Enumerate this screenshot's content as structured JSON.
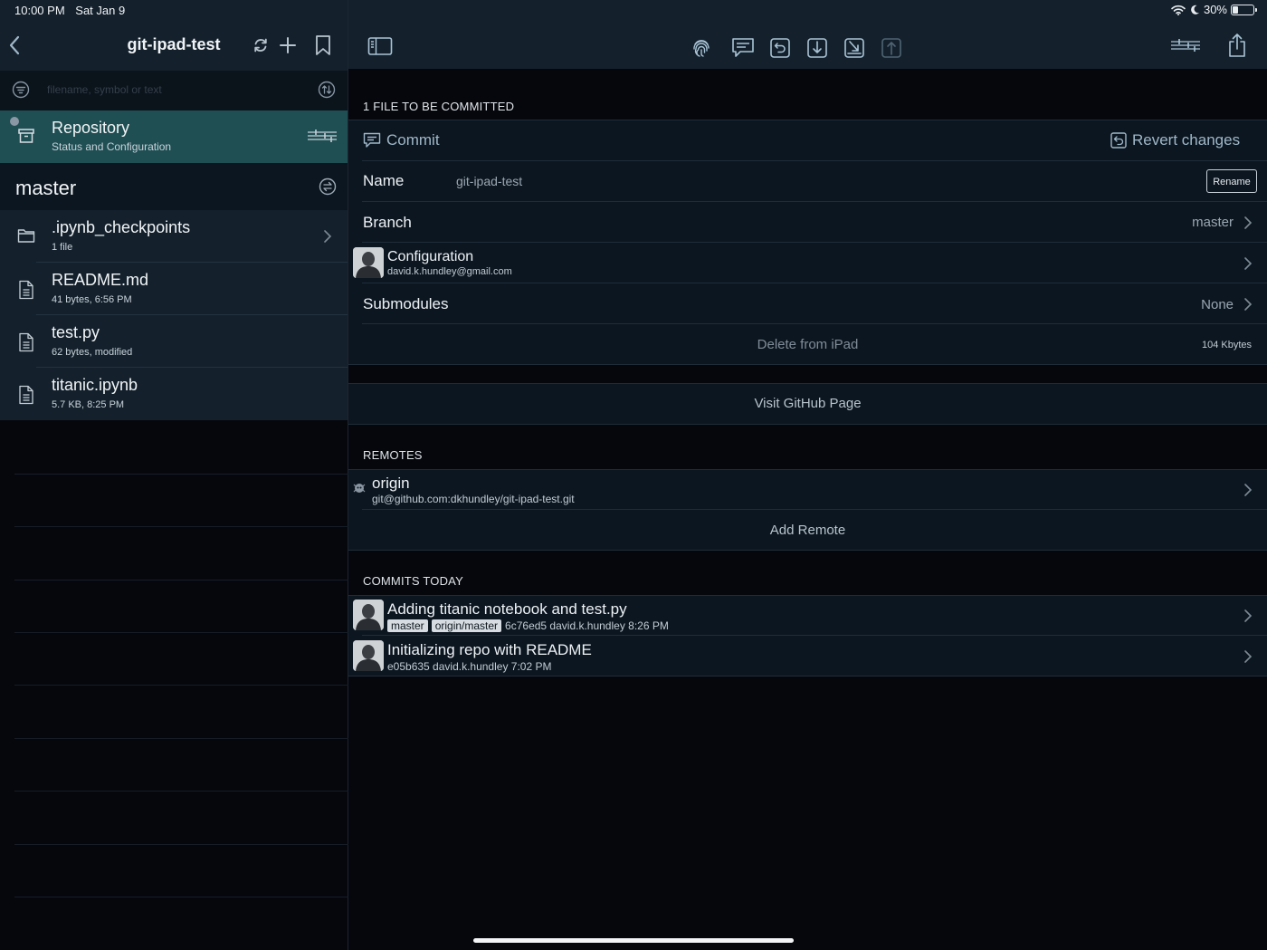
{
  "status_bar": {
    "time": "10:00 PM",
    "date": "Sat Jan 9",
    "battery": "30%",
    "battery_level": 0.3
  },
  "sidebar": {
    "title": "git-ipad-test",
    "search_placeholder": "filename, symbol or text",
    "repository": {
      "title": "Repository",
      "subtitle": "Status and Configuration"
    },
    "branch": "master",
    "files": [
      {
        "name": ".ipynb_checkpoints",
        "detail": "1 file",
        "icon": "folder-icon"
      },
      {
        "name": "README.md",
        "detail": "41 bytes, 6:56 PM",
        "icon": "file-icon"
      },
      {
        "name": "test.py",
        "detail": "62 bytes, modified",
        "icon": "file-icon"
      },
      {
        "name": "titanic.ipynb",
        "detail": "5.7 KB, 8:25 PM",
        "icon": "file-icon"
      }
    ]
  },
  "main": {
    "commit_section": {
      "header": "1 FILE TO BE COMMITTED",
      "commit_label": "Commit",
      "revert_label": "Revert changes"
    },
    "name_row": {
      "label": "Name",
      "value": "git-ipad-test",
      "rename_label": "Rename"
    },
    "branch_row": {
      "label": "Branch",
      "value": "master"
    },
    "configuration_row": {
      "label": "Configuration",
      "email": "david.k.hundley@gmail.com"
    },
    "submodules_row": {
      "label": "Submodules",
      "value": "None"
    },
    "delete_row": {
      "label": "Delete from iPad",
      "size": "104 Kbytes"
    },
    "visit_github_label": "Visit GitHub Page",
    "remotes": {
      "header": "REMOTES",
      "items": [
        {
          "name": "origin",
          "url": "git@github.com:dkhundley/git-ipad-test.git"
        }
      ],
      "add_label": "Add Remote"
    },
    "commits": {
      "header": "COMMITS TODAY",
      "items": [
        {
          "message": "Adding titanic notebook and test.py",
          "tags": [
            "master",
            "origin/master"
          ],
          "meta": "6c76ed5 david.k.hundley 8:26 PM"
        },
        {
          "message": "Initializing repo with README",
          "tags": [],
          "meta": "e05b635 david.k.hundley 7:02 PM"
        }
      ]
    }
  }
}
